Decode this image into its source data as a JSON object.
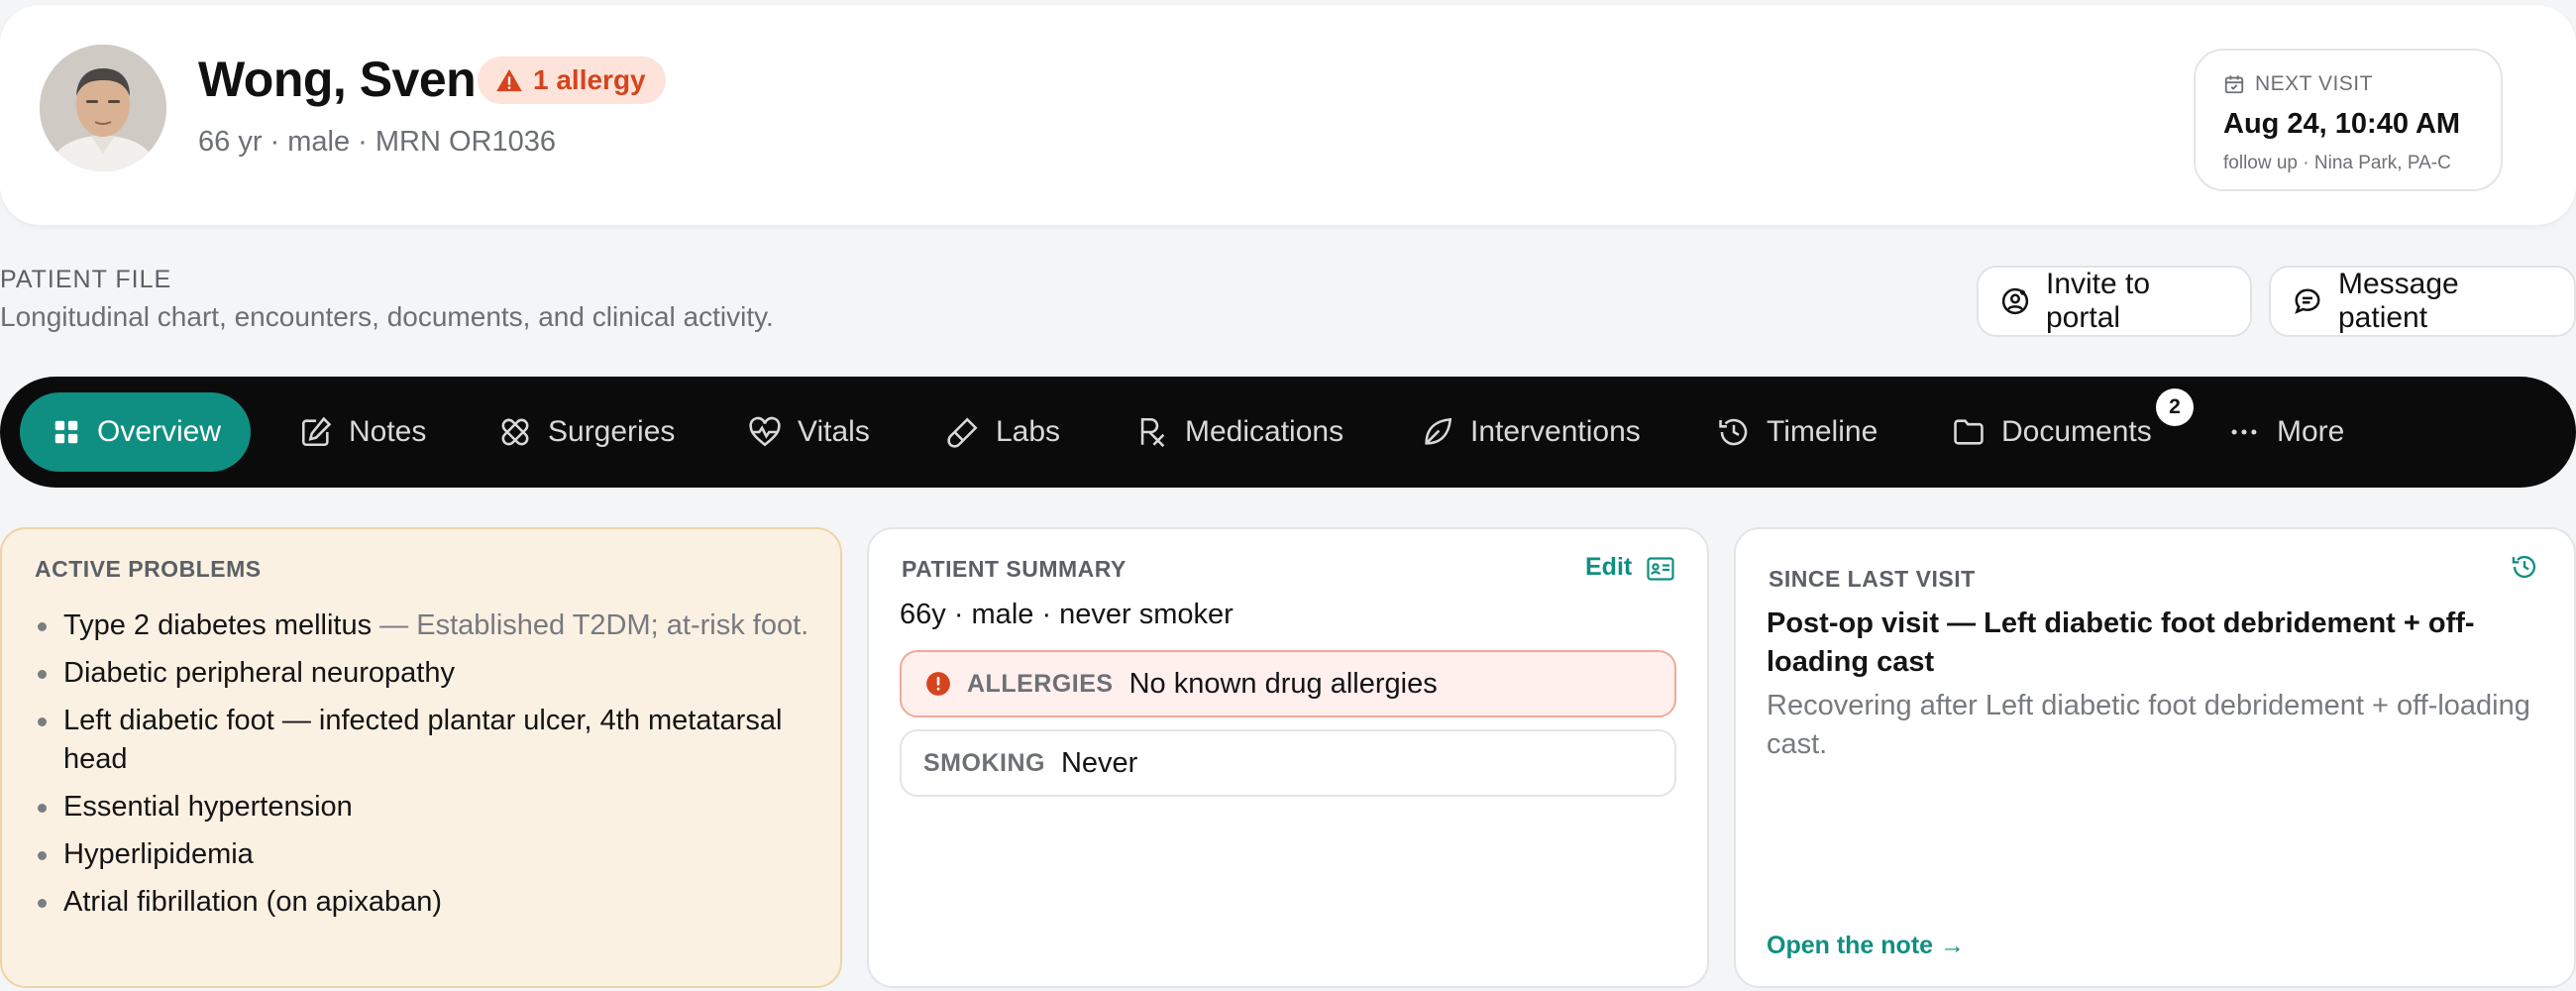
{
  "header": {
    "patient_name": "Wong, Sven",
    "allergy_badge": "1 allergy",
    "patient_meta": "66 yr · male · MRN OR1036"
  },
  "next_visit": {
    "label": "NEXT VISIT",
    "time": "Aug 24, 10:40 AM",
    "detail": "follow up · Nina Park, PA-C"
  },
  "page": {
    "section_label": "PATIENT FILE",
    "description": "Longitudinal chart, encounters, documents, and clinical activity."
  },
  "actions": {
    "invite": "Invite to portal",
    "message": "Message patient"
  },
  "nav": {
    "items": [
      {
        "label": "Overview",
        "icon": "grid-icon"
      },
      {
        "label": "Notes",
        "icon": "edit-icon"
      },
      {
        "label": "Surgeries",
        "icon": "bandage-icon"
      },
      {
        "label": "Vitals",
        "icon": "heart-pulse-icon"
      },
      {
        "label": "Labs",
        "icon": "pipette-icon"
      },
      {
        "label": "Medications",
        "icon": "rx-icon"
      },
      {
        "label": "Interventions",
        "icon": "leaf-icon"
      },
      {
        "label": "Timeline",
        "icon": "history-icon"
      },
      {
        "label": "Documents",
        "icon": "folder-icon"
      },
      {
        "label": "More",
        "icon": "more-icon"
      }
    ],
    "documents_badge": "2"
  },
  "active_problems": {
    "title": "ACTIVE PROBLEMS",
    "items": [
      {
        "text": "Type 2 diabetes mellitus",
        "note": " — Established T2DM; at-risk foot."
      },
      {
        "text": "Diabetic peripheral neuropathy"
      },
      {
        "text": "Left diabetic foot — infected plantar ulcer, 4th metatarsal head"
      },
      {
        "text": "Essential hypertension"
      },
      {
        "text": "Hyperlipidemia"
      },
      {
        "text": "Atrial fibrillation (on apixaban)"
      }
    ]
  },
  "summary": {
    "title": "PATIENT SUMMARY",
    "edit": "Edit",
    "line": "66y · male · never smoker",
    "allergies_label": "ALLERGIES",
    "allergies_value": "No known drug allergies",
    "smoking_label": "SMOKING",
    "smoking_value": "Never"
  },
  "since_last_visit": {
    "title": "SINCE LAST VISIT",
    "heading": "Post-op visit — Left diabetic foot debridement + off-loading cast",
    "body": "Recovering after Left diabetic foot debridement + off-loading cast.",
    "link": "Open the note →"
  },
  "colors": {
    "accent": "#0f8f82",
    "allergy": "#d5441d",
    "navbar": "#0b0b0b",
    "problems_bg": "#fbf1e3"
  }
}
